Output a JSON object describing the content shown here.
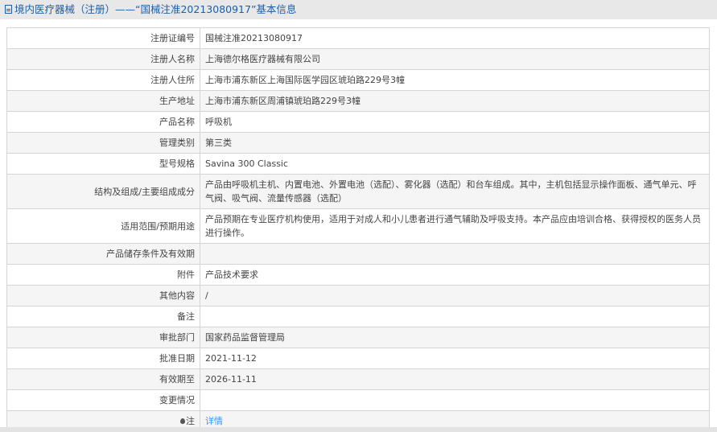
{
  "header": {
    "title": "境内医疗器械（注册）——“国械注准20213080917”基本信息",
    "icon": "document-icon"
  },
  "rows": [
    {
      "label": "注册证编号",
      "value": "国械注准20213080917"
    },
    {
      "label": "注册人名称",
      "value": "上海德尔格医疗器械有限公司"
    },
    {
      "label": "注册人住所",
      "value": "上海市浦东新区上海国际医学园区琥珀路229号3幢"
    },
    {
      "label": "生产地址",
      "value": "上海市浦东新区周浦镇琥珀路229号3幢"
    },
    {
      "label": "产品名称",
      "value": "呼吸机"
    },
    {
      "label": "管理类别",
      "value": "第三类"
    },
    {
      "label": "型号规格",
      "value": "Savina 300 Classic"
    },
    {
      "label": "结构及组成/主要组成成分",
      "value": "产品由呼吸机主机、内置电池、外置电池（选配）、雾化器（选配）和台车组成。其中，主机包括显示操作面板、通气单元、呼气阀、吸气阀、流量传感器（选配）"
    },
    {
      "label": "适用范围/预期用途",
      "value": "产品预期在专业医疗机构使用，适用于对成人和小儿患者进行通气辅助及呼吸支持。本产品应由培训合格、获得授权的医务人员进行操作。"
    },
    {
      "label": "产品储存条件及有效期",
      "value": ""
    },
    {
      "label": "附件",
      "value": "产品技术要求"
    },
    {
      "label": "其他内容",
      "value": "/"
    },
    {
      "label": "备注",
      "value": ""
    },
    {
      "label": "审批部门",
      "value": "国家药品监督管理局"
    },
    {
      "label": "批准日期",
      "value": "2021-11-12"
    },
    {
      "label": "有效期至",
      "value": "2026-11-11"
    },
    {
      "label": "变更情况",
      "value": ""
    },
    {
      "label": "注",
      "value": "详情",
      "icon": "pin-icon"
    }
  ]
}
